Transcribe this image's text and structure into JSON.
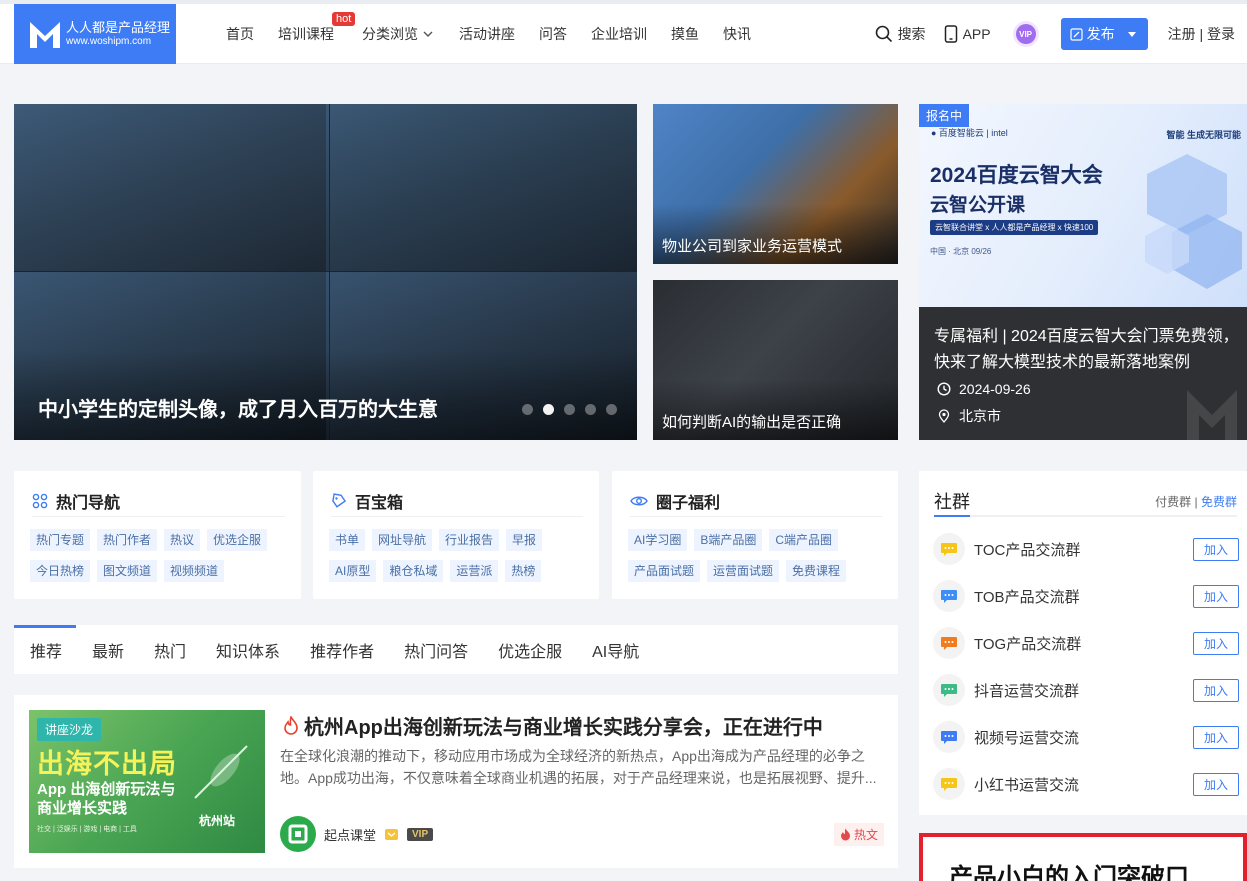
{
  "brand": {
    "name_cn": "人人都是产品经理",
    "url": "www.woshipm.com",
    "color": "#3d7cf5"
  },
  "nav": {
    "items": [
      "首页",
      "培训课程",
      "分类浏览",
      "活动讲座",
      "问答",
      "企业培训",
      "摸鱼",
      "快讯"
    ],
    "hot_label": "hot"
  },
  "header_right": {
    "search": "搜索",
    "app": "APP",
    "vip": "VIP",
    "publish": "发布",
    "register": "注册",
    "separator": "|",
    "login": "登录"
  },
  "hero": {
    "title": "中小学生的定制头像，成了月入百万的大生意",
    "slides": 5,
    "active_slide": 2
  },
  "side_cards": [
    {
      "caption": "物业公司到家业务运营模式"
    },
    {
      "caption": "如何判断AI的输出是否正确"
    }
  ],
  "event": {
    "badge": "报名中",
    "poster_title": "2024百度云智大会",
    "poster_sub": "云智公开课",
    "poster_line": "云智联合讲堂 x 人人都是产品经理 x 快速100",
    "poster_place": "中国 · 北京  09/26",
    "poster_slogan": "智能 生成无限可能",
    "title": "专属福利 | 2024百度云智大会门票免费领，快来了解大模型技术的最新落地案例",
    "date": "2024-09-26",
    "city": "北京市"
  },
  "boxes": [
    {
      "title": "热门导航",
      "icon": "grid-icon",
      "tags": [
        "热门专题",
        "热门作者",
        "热议",
        "优选企服",
        "今日热榜",
        "图文频道",
        "视频频道"
      ]
    },
    {
      "title": "百宝箱",
      "icon": "tag-icon",
      "tags": [
        "书单",
        "网址导航",
        "行业报告",
        "早报",
        "AI原型",
        "粮仓私域",
        "运营派",
        "热榜"
      ]
    },
    {
      "title": "圈子福利",
      "icon": "eye-icon",
      "tags": [
        "AI学习圈",
        "B端产品圈",
        "C端产品圈",
        "产品面试题",
        "运营面试题",
        "免费课程"
      ]
    }
  ],
  "tabs": [
    "推荐",
    "最新",
    "热门",
    "知识体系",
    "推荐作者",
    "热门问答",
    "优选企服",
    "AI导航"
  ],
  "article": {
    "badge": "讲座沙龙",
    "img_title1": "出海不出局",
    "img_title2": "App 出海创新玩法与",
    "img_title3": "商业增长实践",
    "img_city": "杭州站",
    "img_tags": "社交 | 泛娱乐 | 游戏 | 电商 | 工具",
    "title": "杭州App出海创新玩法与商业增长实践分享会，正在进行中",
    "desc": "在全球化浪潮的推动下，移动应用市场成为全球经济的新热点，App出海成为产品经理的必争之地。App成功出海，不仅意味着全球商业机遇的拓展，对于产品经理来说，也是拓展视野、提升...",
    "author": "起点课堂",
    "vip": "VIP",
    "hot": "热文"
  },
  "side_groups": {
    "title": "社群",
    "paid": "付费群",
    "sep": "|",
    "free": "免费群",
    "join_label": "加入",
    "items": [
      {
        "name": "TOC产品交流群",
        "color": "#f5c518"
      },
      {
        "name": "TOB产品交流群",
        "color": "#3d8ff5"
      },
      {
        "name": "TOG产品交流群",
        "color": "#f07c1f"
      },
      {
        "name": "抖音运营交流群",
        "color": "#3dbb87"
      },
      {
        "name": "视频号运营交流",
        "color": "#3d7cf5"
      },
      {
        "name": "小红书运营交流",
        "color": "#f5c518"
      }
    ]
  },
  "promo": {
    "title": "产品小白的入门突破口"
  }
}
